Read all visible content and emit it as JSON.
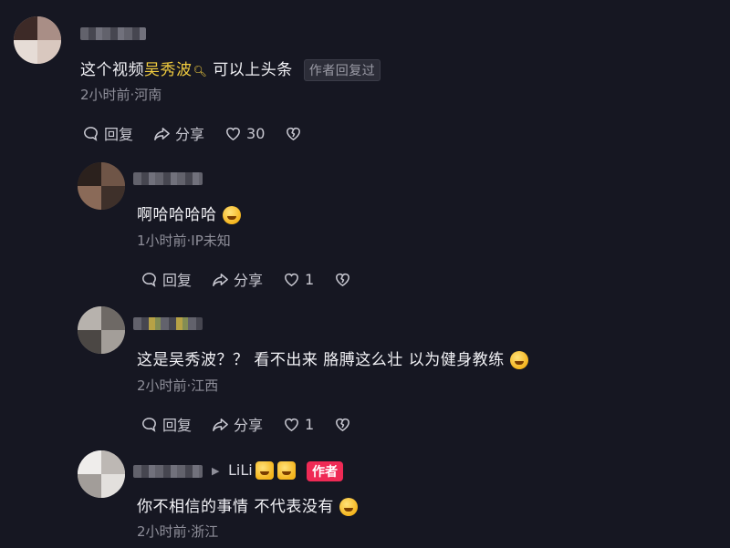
{
  "comments": [
    {
      "text_plain_before": "这个视频",
      "text_highlight": "吴秀波",
      "text_plain_after": "可以上头条",
      "badge": "作者回复过",
      "meta": "2小时前·河南",
      "reply_label": "回复",
      "share_label": "分享",
      "like_count": "30"
    },
    {
      "text": "啊哈哈哈哈",
      "meta": "1小时前·IP未知",
      "reply_label": "回复",
      "share_label": "分享",
      "like_count": "1"
    },
    {
      "text": "这是吴秀波？？ 看不出来 胳膊这么壮 以为健身教练",
      "meta": "2小时前·江西",
      "reply_label": "回复",
      "share_label": "分享",
      "like_count": "1"
    },
    {
      "reply_to": "LiLi",
      "author_badge": "作者",
      "text": "你不相信的事情 不代表没有",
      "meta": "2小时前·浙江"
    }
  ],
  "colors": {
    "background": "#161722",
    "highlight": "#f1cc3f",
    "author_badge": "#ef2a55"
  }
}
